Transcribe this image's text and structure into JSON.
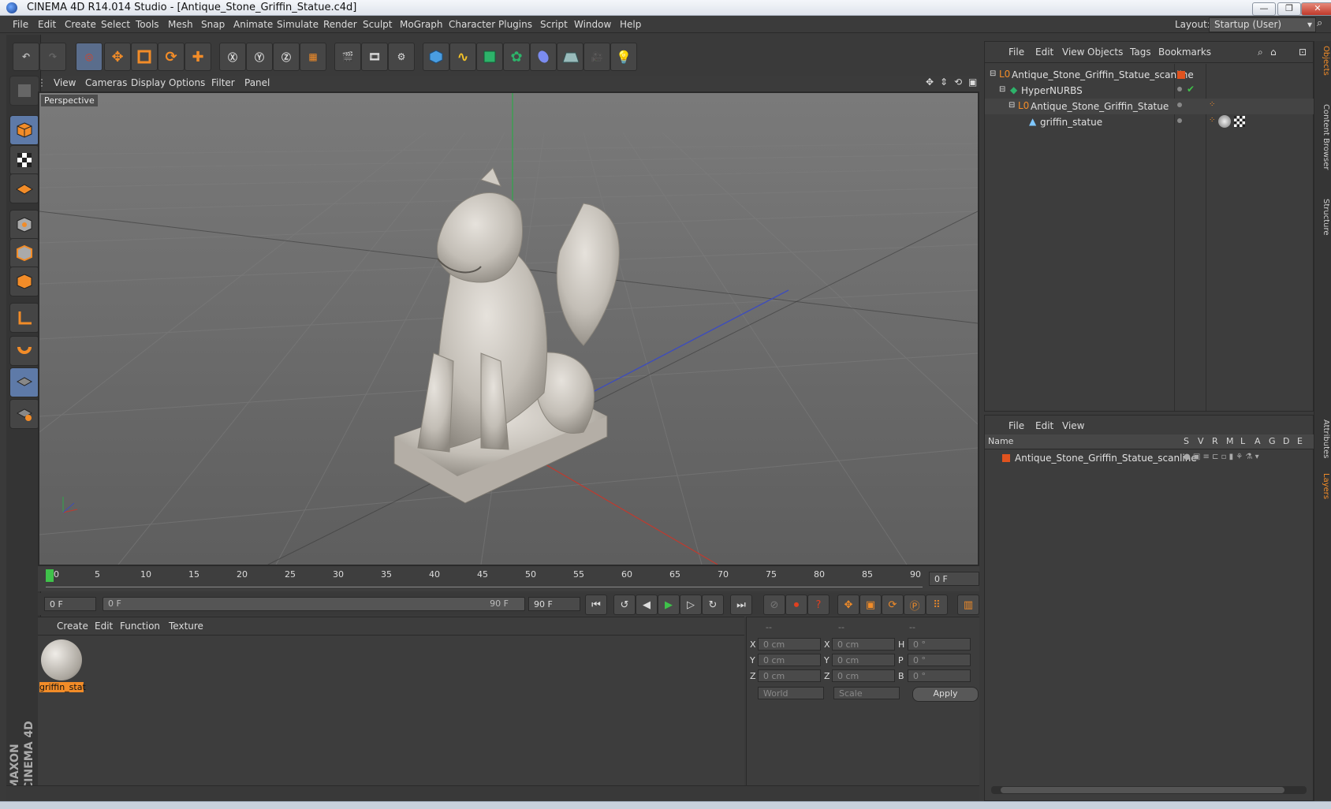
{
  "window": {
    "title": "CINEMA 4D R14.014 Studio - [Antique_Stone_Griffin_Statue.c4d]",
    "minimize": "—",
    "restore": "❐",
    "close": "✕"
  },
  "menubar": {
    "items": [
      "File",
      "Edit",
      "Create",
      "Select",
      "Tools",
      "Mesh",
      "Snap",
      "Animate",
      "Simulate",
      "Render",
      "Sculpt",
      "MoGraph",
      "Character",
      "Plugins",
      "Script",
      "Window",
      "Help"
    ],
    "layout_label": "Layout:",
    "layout_value": "Startup (User)"
  },
  "viewport": {
    "menu": [
      "View",
      "Cameras",
      "Display",
      "Options",
      "Filter",
      "Panel"
    ],
    "label": "Perspective"
  },
  "timeline": {
    "ticks": [
      "0",
      "5",
      "10",
      "15",
      "20",
      "25",
      "30",
      "35",
      "40",
      "45",
      "50",
      "55",
      "60",
      "65",
      "70",
      "75",
      "80",
      "85",
      "90"
    ],
    "current_frame": "0 F"
  },
  "playback": {
    "start_field": "0 F",
    "range_start": "0 F",
    "range_end": "90 F",
    "end_field": "90 F"
  },
  "materials": {
    "menu": [
      "Create",
      "Edit",
      "Function",
      "Texture"
    ],
    "items": [
      {
        "label": "griffin_stat"
      }
    ]
  },
  "coordinates": {
    "headers": [
      "--",
      "--",
      "--"
    ],
    "rows": [
      {
        "a_label": "X",
        "a_val": "0 cm",
        "b_label": "X",
        "b_val": "0 cm",
        "c_label": "H",
        "c_val": "0 °"
      },
      {
        "a_label": "Y",
        "a_val": "0 cm",
        "b_label": "Y",
        "b_val": "0 cm",
        "c_label": "P",
        "c_val": "0 °"
      },
      {
        "a_label": "Z",
        "a_val": "0 cm",
        "b_label": "Z",
        "b_val": "0 cm",
        "c_label": "B",
        "c_val": "0 °"
      }
    ],
    "mode1": "World",
    "mode2": "Scale",
    "apply": "Apply"
  },
  "objects": {
    "menu": [
      "File",
      "Edit",
      "View",
      "Objects",
      "Tags",
      "Bookmarks"
    ],
    "tree": [
      {
        "name": "Antique_Stone_Griffin_Statue_scanline"
      },
      {
        "name": "HyperNURBS"
      },
      {
        "name": "Antique_Stone_Griffin_Statue"
      },
      {
        "name": "griffin_statue"
      }
    ]
  },
  "layers": {
    "menu": [
      "File",
      "Edit",
      "View"
    ],
    "columns": [
      "Name",
      "S",
      "V",
      "R",
      "M",
      "L",
      "A",
      "G",
      "D",
      "E"
    ],
    "rows": [
      {
        "name": "Antique_Stone_Griffin_Statue_scanline"
      }
    ]
  },
  "sidetabs": [
    "Objects",
    "Content Browser",
    "Structure",
    "Attributes",
    "Layers"
  ],
  "branding": "MAXON CINEMA 4D",
  "colors": {
    "accent": "#f28c28",
    "layer_color": "#e0531f",
    "axis_x": "#c0392b",
    "axis_y": "#27ae60",
    "axis_z": "#2c3e9a"
  }
}
